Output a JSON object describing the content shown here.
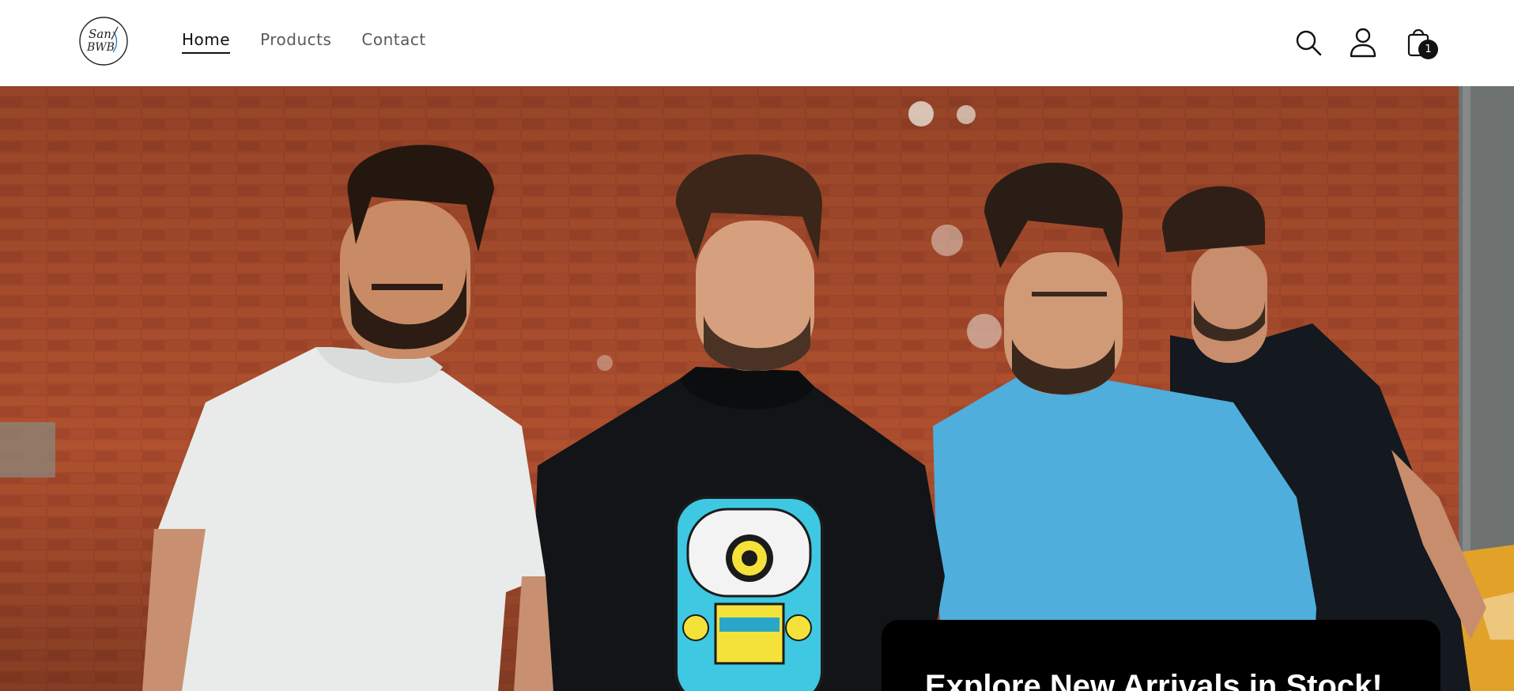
{
  "brand": {
    "logo_text_line1": "San",
    "logo_text_line2": "BWB"
  },
  "nav": {
    "items": [
      {
        "label": "Home",
        "active": true
      },
      {
        "label": "Products",
        "active": false
      },
      {
        "label": "Contact",
        "active": false
      }
    ]
  },
  "header_icons": {
    "search": "search-icon",
    "account": "account-icon",
    "cart": "cart-icon",
    "cart_count": "1"
  },
  "hero": {
    "image_description_icon": "hero-image",
    "banner_title": "Explore New Arrivals in Stock!"
  },
  "colors": {
    "brick": "#a4492c",
    "banner_bg": "#000000",
    "text_dark": "#121212"
  }
}
